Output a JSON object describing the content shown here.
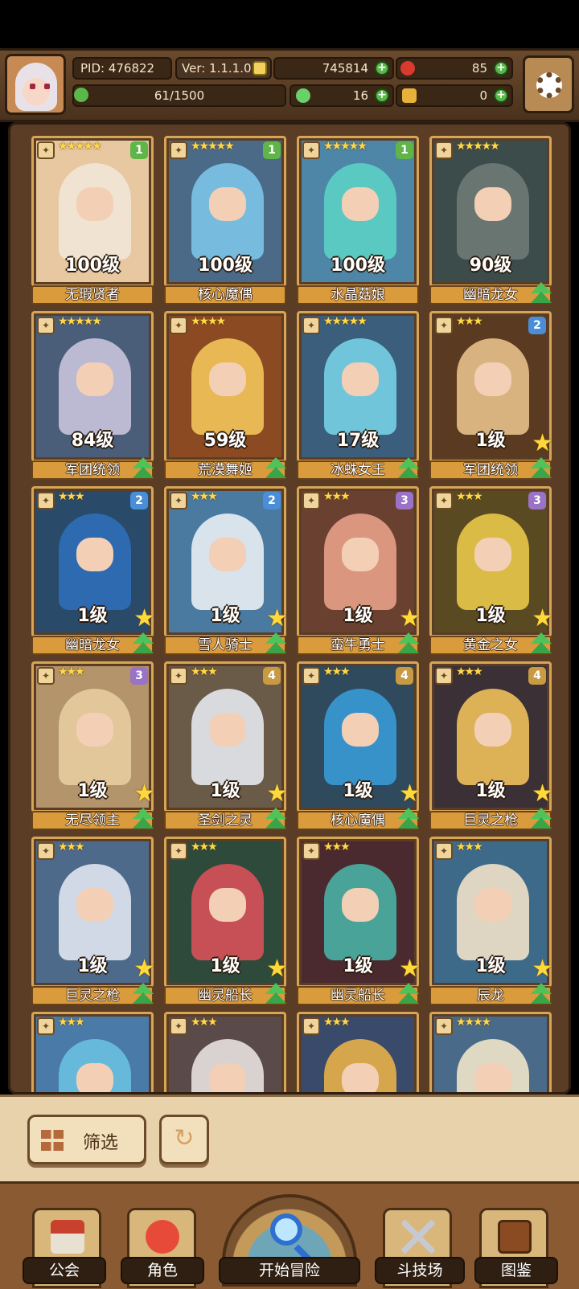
{
  "header": {
    "pid": "PID: 476822",
    "version": "Ver: 1.1.1.0",
    "gold": "745814",
    "apples": "85",
    "exp": "61/1500",
    "clover": "16",
    "keys": "0"
  },
  "cards": [
    {
      "level": "100级",
      "name": "无瑕贤者",
      "stars": "★★★★★",
      "rank": "1",
      "rank_color": "#5fb548",
      "art": "#e8c8a0",
      "hair": "#f1e6d6",
      "up": false,
      "star_badge": false
    },
    {
      "level": "100级",
      "name": "核心魔偶",
      "stars": "★★★★★",
      "rank": "1",
      "rank_color": "#5fb548",
      "art": "#4a6a88",
      "hair": "#7cc4e8",
      "up": false,
      "star_badge": false
    },
    {
      "level": "100级",
      "name": "水晶菇娘",
      "stars": "★★★★★",
      "rank": "1",
      "rank_color": "#5fb548",
      "art": "#4d86a6",
      "hair": "#5cd0c4",
      "up": false,
      "star_badge": false
    },
    {
      "level": "90级",
      "name": "幽暗龙女",
      "stars": "★★★★★",
      "rank": "",
      "rank_color": "",
      "art": "#3c4c4a",
      "hair": "#6e7a76",
      "up": true,
      "star_badge": false
    },
    {
      "level": "84级",
      "name": "军团统领",
      "stars": "★★★★★",
      "rank": "",
      "rank_color": "",
      "art": "#4a5e7a",
      "hair": "#c8c4dc",
      "up": true,
      "star_badge": false
    },
    {
      "level": "59级",
      "name": "荒漠舞姬",
      "stars": "★★★★",
      "rank": "",
      "rank_color": "",
      "art": "#8c4a22",
      "hair": "#f2c45a",
      "up": true,
      "star_badge": false
    },
    {
      "level": "17级",
      "name": "冰蛛女王",
      "stars": "★★★★★",
      "rank": "",
      "rank_color": "",
      "art": "#3a5e7c",
      "hair": "#78d0e6",
      "up": true,
      "star_badge": false
    },
    {
      "level": "1级",
      "name": "军团统领",
      "stars": "★★★",
      "rank": "2",
      "rank_color": "#4a8ed8",
      "art": "#5a3a20",
      "hair": "#e6c08a",
      "up": true,
      "star_badge": true
    },
    {
      "level": "1级",
      "name": "幽暗龙女",
      "stars": "★★★",
      "rank": "2",
      "rank_color": "#4a8ed8",
      "art": "#2a4a6a",
      "hair": "#2e6eb8",
      "up": true,
      "star_badge": true
    },
    {
      "level": "1级",
      "name": "雪人骑士",
      "stars": "★★★",
      "rank": "2",
      "rank_color": "#4a8ed8",
      "art": "#4a7aa0",
      "hair": "#e8eef4",
      "up": true,
      "star_badge": true
    },
    {
      "level": "1级",
      "name": "蛮牛勇士",
      "stars": "★★★",
      "rank": "3",
      "rank_color": "#9a72c8",
      "art": "#6a4030",
      "hair": "#e8a08a",
      "up": true,
      "star_badge": true
    },
    {
      "level": "1级",
      "name": "黄金之女",
      "stars": "★★★",
      "rank": "3",
      "rank_color": "#9a72c8",
      "art": "#5a4a22",
      "hair": "#e8c84a",
      "up": true,
      "star_badge": true
    },
    {
      "level": "1级",
      "name": "无尽领主",
      "stars": "★★★",
      "rank": "3",
      "rank_color": "#9a72c8",
      "art": "#b4946a",
      "hair": "#e6cca0",
      "up": true,
      "star_badge": true
    },
    {
      "level": "1级",
      "name": "圣剑之灵",
      "stars": "★★★",
      "rank": "4",
      "rank_color": "#c89a42",
      "art": "#6a5a48",
      "hair": "#e6e8ee",
      "up": true,
      "star_badge": true
    },
    {
      "level": "1级",
      "name": "核心魔偶",
      "stars": "★★★",
      "rank": "4",
      "rank_color": "#c89a42",
      "art": "#2e4a5c",
      "hair": "#3a9ad6",
      "up": true,
      "star_badge": true
    },
    {
      "level": "1级",
      "name": "巨灵之枪",
      "stars": "★★★",
      "rank": "4",
      "rank_color": "#c89a42",
      "art": "#3a3036",
      "hair": "#f0c05a",
      "up": true,
      "star_badge": true
    },
    {
      "level": "1级",
      "name": "巨灵之枪",
      "stars": "★★★",
      "rank": "",
      "rank_color": "",
      "art": "#4e6a8a",
      "hair": "#dfe6ee",
      "up": true,
      "star_badge": true
    },
    {
      "level": "1级",
      "name": "幽灵船长",
      "stars": "★★★",
      "rank": "",
      "rank_color": "",
      "art": "#2e4a3a",
      "hair": "#d8505a",
      "up": true,
      "star_badge": true
    },
    {
      "level": "1级",
      "name": "幽灵船长",
      "stars": "★★★",
      "rank": "",
      "rank_color": "",
      "art": "#4a2a2e",
      "hair": "#4ab0a4",
      "up": true,
      "star_badge": true
    },
    {
      "level": "1级",
      "name": "辰龙",
      "stars": "★★★",
      "rank": "",
      "rank_color": "",
      "art": "#3e6a8a",
      "hair": "#f0e2c8",
      "up": true,
      "star_badge": true
    },
    {
      "level": "",
      "name": "",
      "stars": "★★★",
      "rank": "",
      "rank_color": "",
      "art": "#4a7aa8",
      "hair": "#6ac0e0",
      "up": false,
      "star_badge": false
    },
    {
      "level": "",
      "name": "",
      "stars": "★★★",
      "rank": "",
      "rank_color": "",
      "art": "#5a4a4a",
      "hair": "#e8e0e0",
      "up": false,
      "star_badge": false
    },
    {
      "level": "",
      "name": "",
      "stars": "★★★",
      "rank": "",
      "rank_color": "",
      "art": "#3a4a6a",
      "hair": "#e8b04a",
      "up": false,
      "star_badge": false
    },
    {
      "level": "",
      "name": "",
      "stars": "★★★★",
      "rank": "",
      "rank_color": "",
      "art": "#4a6a8a",
      "hair": "#f0e4c8",
      "up": false,
      "star_badge": false
    }
  ],
  "filter": {
    "label": "筛选",
    "reset_icon": "refresh-icon"
  },
  "nav": {
    "guild": "公会",
    "character": "角色",
    "adventure": "开始冒险",
    "arena": "斗技场",
    "codex": "图鉴"
  }
}
